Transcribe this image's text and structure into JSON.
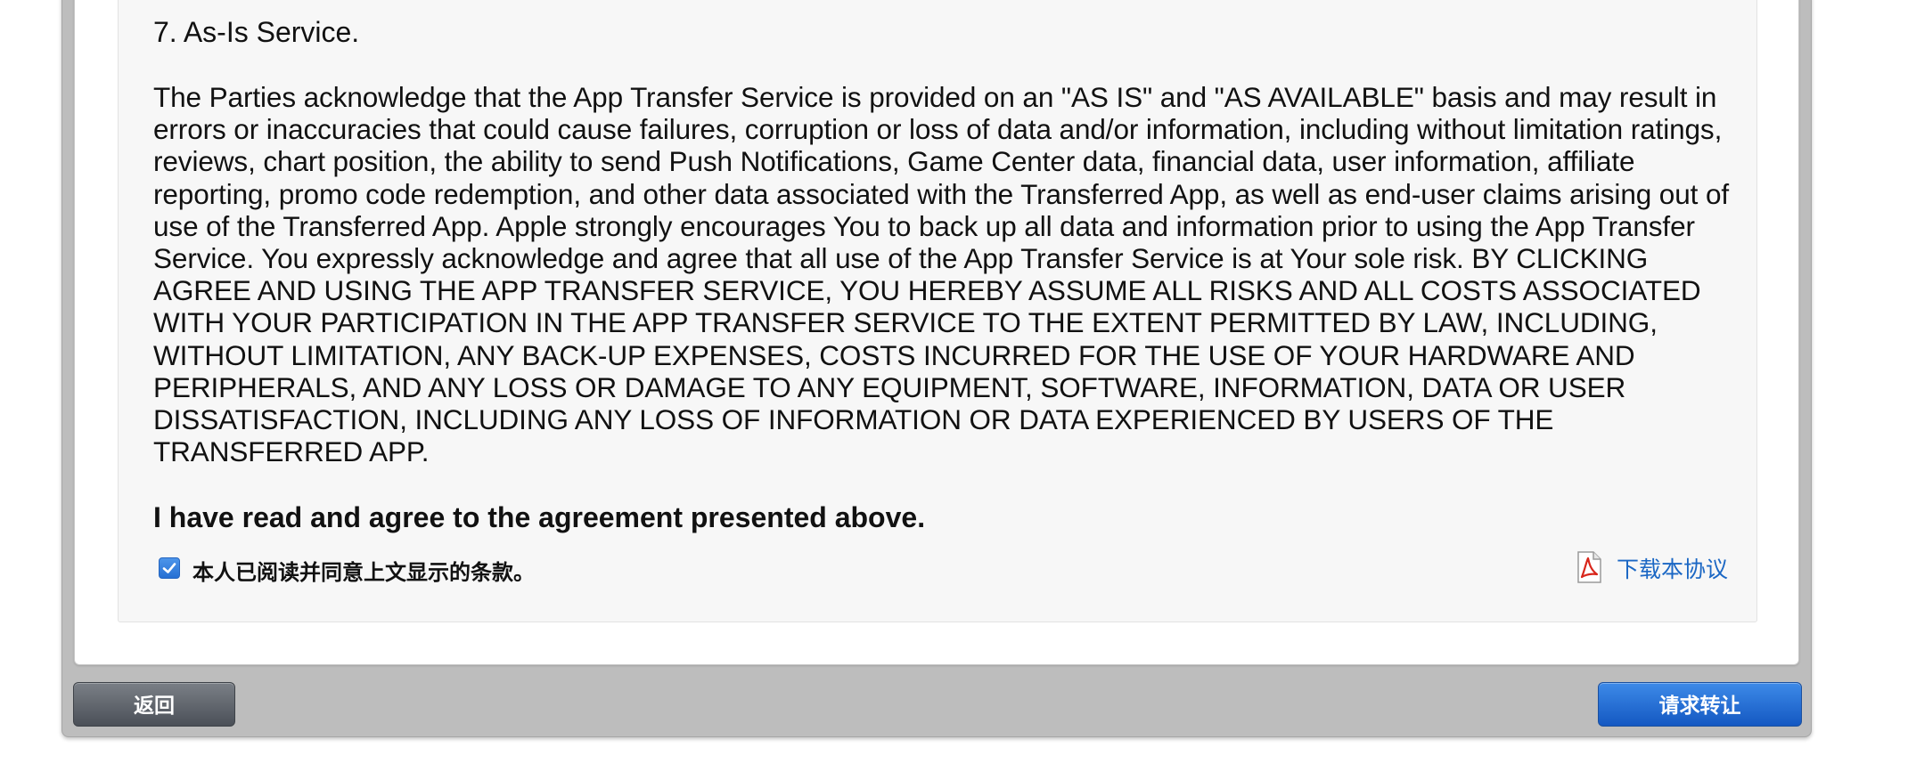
{
  "agreement": {
    "section_heading": "7. As-Is Service.",
    "section_body": "The Parties acknowledge that the App Transfer Service is provided on an \"AS IS\" and \"AS AVAILABLE\" basis and may result in errors or inaccuracies that could cause failures, corruption or loss of data and/or information, including without limitation ratings, reviews, chart position, the ability to send Push Notifications, Game Center data, financial data, user information, affiliate reporting, promo code redemption, and other data associated with the Transferred App, as well as end-user claims arising out of use of the Transferred App. Apple strongly encourages You to back up all data and information prior to using the App Transfer Service. You expressly acknowledge and agree that all use of the App Transfer Service is at Your sole risk. BY CLICKING AGREE AND USING THE APP TRANSFER SERVICE, YOU HEREBY ASSUME ALL RISKS AND ALL COSTS ASSOCIATED WITH YOUR PARTICIPATION IN THE APP TRANSFER SERVICE TO THE EXTENT PERMITTED BY LAW, INCLUDING, WITHOUT LIMITATION, ANY BACK-UP EXPENSES, COSTS INCURRED FOR THE USE OF YOUR HARDWARE AND PERIPHERALS, AND ANY LOSS OR DAMAGE TO ANY EQUIPMENT, SOFTWARE, INFORMATION, DATA OR USER DISSATISFACTION, INCLUDING ANY LOSS OF INFORMATION OR DATA EXPERIENCED BY USERS OF THE TRANSFERRED APP.",
    "agree_statement": "I have read and agree to the agreement presented above.",
    "checkbox_label": "本人已阅读并同意上文显示的条款。",
    "checkbox_checked": true,
    "download_label": "下载本协议"
  },
  "footer": {
    "back_label": "返回",
    "request_label": "请求转让"
  },
  "colors": {
    "link": "#1b67c4",
    "primary_button": "#1d63cf",
    "secondary_button": "#5a5f66",
    "checkbox": "#2f7ce0"
  },
  "icons": {
    "download": "pdf-icon",
    "checkbox": "checkmark-icon"
  }
}
